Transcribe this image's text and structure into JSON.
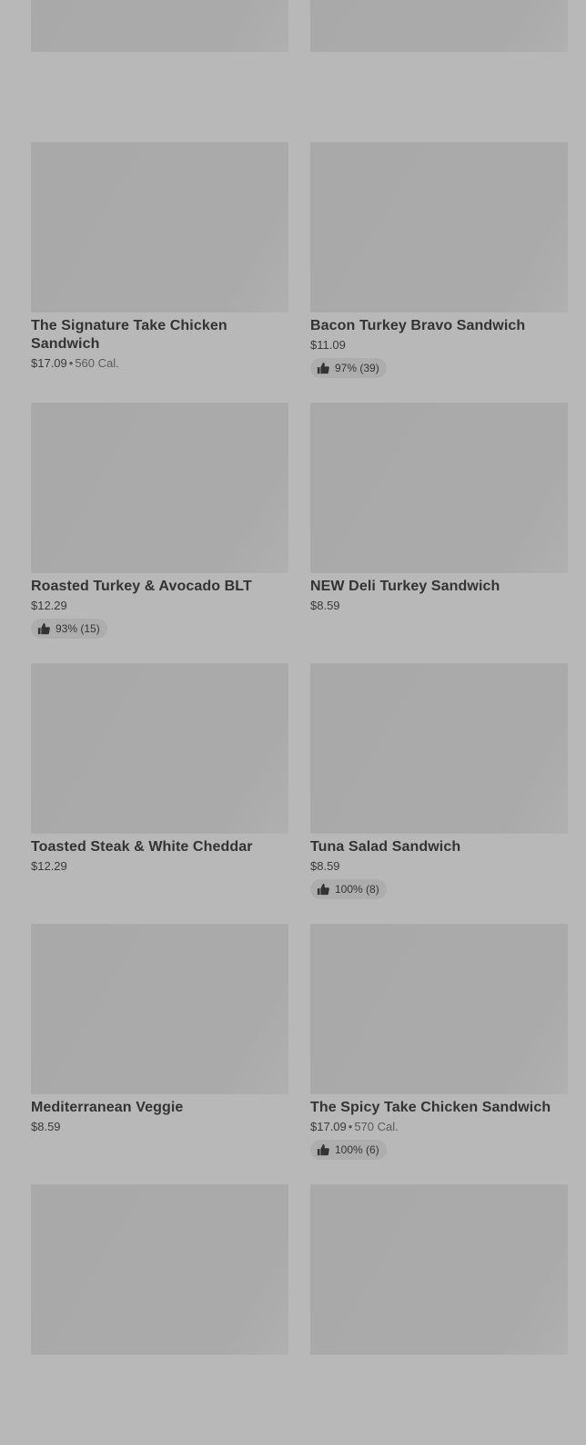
{
  "items": [
    {
      "name": "",
      "price": "",
      "calories": "",
      "rating": ""
    },
    {
      "name": "",
      "price": "",
      "calories": "",
      "rating": ""
    },
    {
      "name": "The Signature Take Chicken Sandwich",
      "price": "$17.09",
      "calories": "560 Cal.",
      "rating": ""
    },
    {
      "name": "Bacon Turkey Bravo Sandwich",
      "price": "$11.09",
      "calories": "",
      "rating": "97% (39)"
    },
    {
      "name": "Roasted Turkey & Avocado BLT",
      "price": "$12.29",
      "calories": "",
      "rating": "93% (15)"
    },
    {
      "name": "NEW Deli Turkey Sandwich",
      "price": "$8.59",
      "calories": "",
      "rating": ""
    },
    {
      "name": "Toasted Steak & White Cheddar",
      "price": "$12.29",
      "calories": "",
      "rating": ""
    },
    {
      "name": "Tuna Salad Sandwich",
      "price": "$8.59",
      "calories": "",
      "rating": "100% (8)"
    },
    {
      "name": "Mediterranean Veggie",
      "price": "$8.59",
      "calories": "",
      "rating": ""
    },
    {
      "name": "The Spicy Take Chicken Sandwich",
      "price": "$17.09",
      "calories": "570 Cal.",
      "rating": "100% (6)"
    },
    {
      "name": "",
      "price": "",
      "calories": "",
      "rating": ""
    },
    {
      "name": "",
      "price": "",
      "calories": "",
      "rating": ""
    }
  ],
  "icons": {
    "rating": "thumbs-up-icon"
  },
  "colors": {
    "overlay_background": "#b8b8b8",
    "image_placeholder": "#aaaaaa",
    "text": "#333333"
  }
}
